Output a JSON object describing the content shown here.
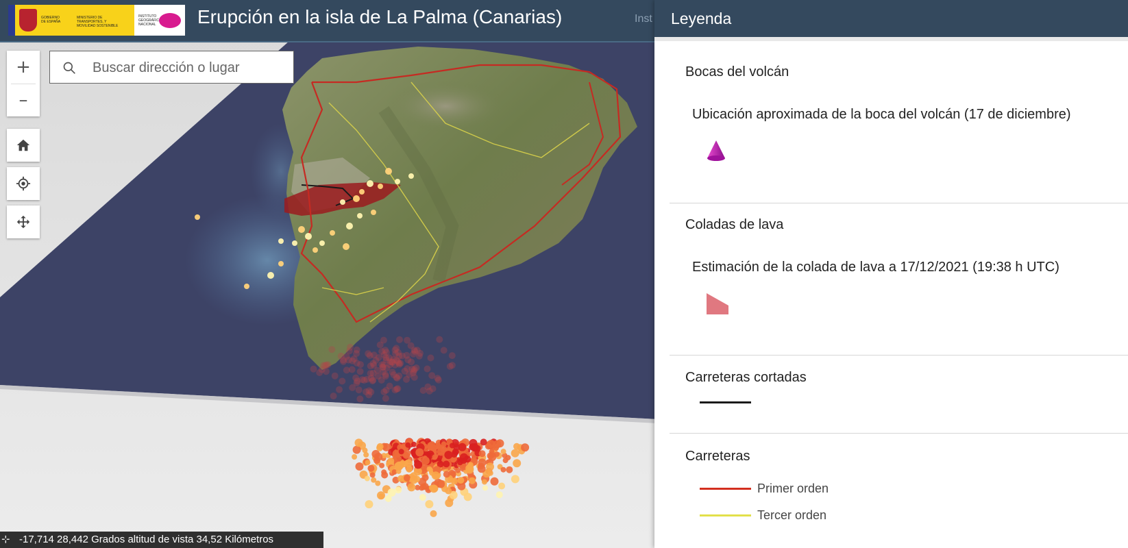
{
  "header": {
    "title": "Erupción en la isla de La Palma (Canarias)",
    "subtitle_cut": "Inst",
    "logo": {
      "gov_text": "GOBIERNO DE ESPAÑA",
      "ministry_text": "MINISTERIO DE TRANSPORTES, Y MOVILIDAD SOSTENIBLE",
      "ign_text": "INSTITUTO GEOGRÁFICO NACIONAL"
    }
  },
  "controls": {
    "zoom_in": "+",
    "zoom_out": "–"
  },
  "search": {
    "placeholder": "Buscar dirección o lugar",
    "value": ""
  },
  "status": {
    "text": "-17,714 28,442 Grados   altitud de vista 34,52 Kilómetros"
  },
  "legend": {
    "title": "Leyenda",
    "sections": [
      {
        "title": "Bocas del volcán",
        "subtitle": "Ubicación aproximada de la boca del volcán (17 de diciembre)",
        "symbol": "magenta-cone"
      },
      {
        "title": "Coladas de lava",
        "subtitle": "Estimación de la colada de lava a 17/12/2021 (19:38 h UTC)",
        "symbol": "pink-polygon"
      },
      {
        "title": "Carreteras cortadas",
        "symbol": "black-line"
      },
      {
        "title": "Carreteras",
        "items": [
          {
            "label": "Primer orden",
            "color": "#d32f1f"
          },
          {
            "label": "Tercer orden",
            "color": "#e2e04a"
          }
        ]
      }
    ]
  },
  "colors": {
    "header_bg": "#34495e",
    "sea": "#3d4366",
    "land": "#6f7d4c",
    "lava": "#9b1b1f",
    "road_primary": "#d32f1f",
    "road_tertiary": "#e2e04a",
    "quake_points": [
      "#fff4b0",
      "#ffd27a",
      "#f9a64a",
      "#ee6a3a",
      "#d92020"
    ]
  }
}
